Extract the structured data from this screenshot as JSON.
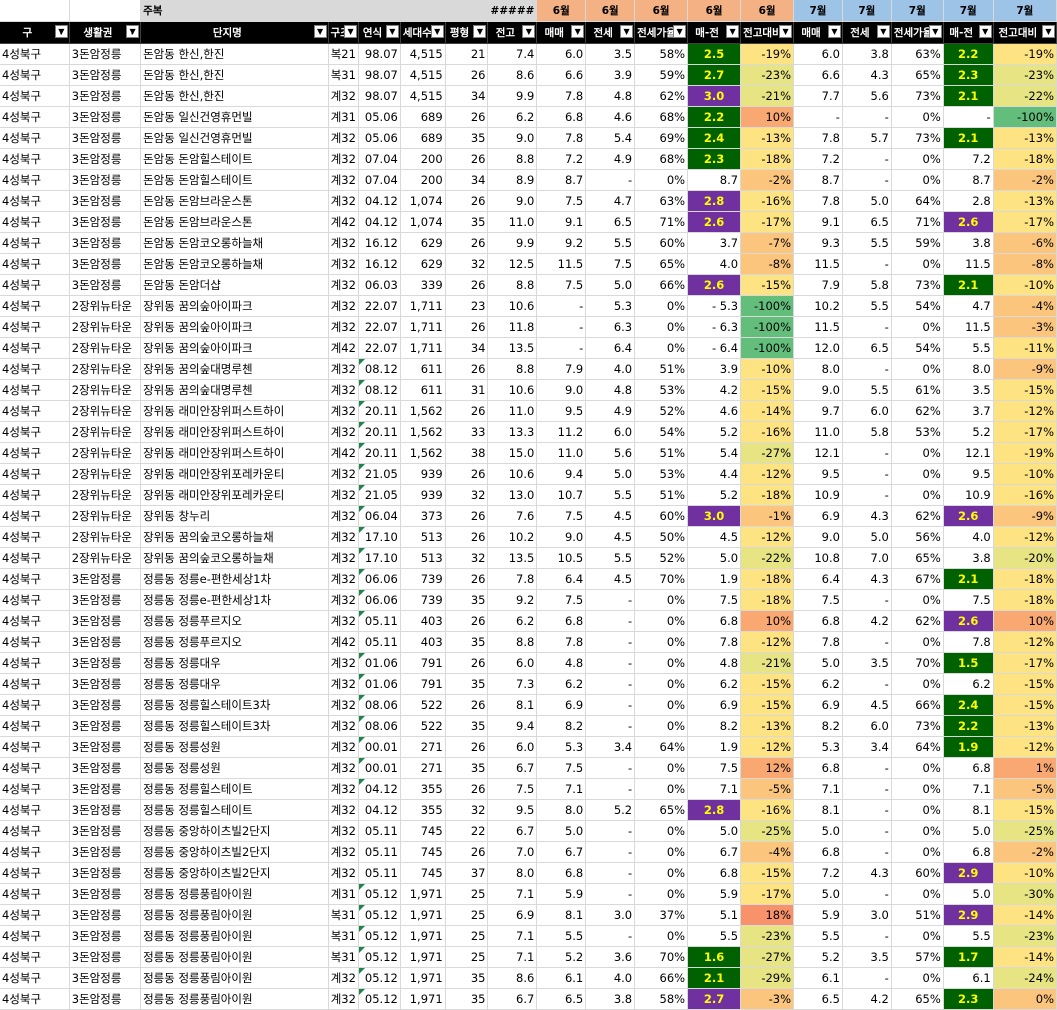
{
  "header_top": {
    "ju": "주복",
    "hash": "#####",
    "m6": "6월",
    "m7": "7월"
  },
  "header_cols": [
    "구",
    "생활권",
    "단지명",
    "구조",
    "연식",
    "세대수",
    "평형",
    "전고",
    "매매",
    "전세",
    "전세가율",
    "매-전",
    "전고대비",
    "매매",
    "전세",
    "전세가율",
    "매-전",
    "전고대비"
  ],
  "rows": [
    [
      "4성북구",
      "3돈암정릉",
      "돈암동 한신,한진",
      "복21",
      "98.07",
      "4,515",
      "21",
      "7.4",
      "6.0",
      "3.5",
      "58%",
      "2.5",
      "-19%",
      "6.0",
      "3.8",
      "63%",
      "2.2",
      "-19%"
    ],
    [
      "4성북구",
      "3돈암정릉",
      "돈암동 한신,한진",
      "복31",
      "98.07",
      "4,515",
      "26",
      "8.6",
      "6.6",
      "3.9",
      "59%",
      "2.7",
      "-23%",
      "6.6",
      "4.3",
      "65%",
      "2.3",
      "-23%"
    ],
    [
      "4성북구",
      "3돈암정릉",
      "돈암동 한신,한진",
      "계32",
      "98.07",
      "4,515",
      "34",
      "9.9",
      "7.8",
      "4.8",
      "62%",
      "3.0",
      "-21%",
      "7.7",
      "5.6",
      "73%",
      "2.1",
      "-22%"
    ],
    [
      "4성북구",
      "3돈암정릉",
      "돈암동 일신건영휴먼빌",
      "계31",
      "05.06",
      "689",
      "26",
      "6.2",
      "6.8",
      "4.6",
      "68%",
      "2.2",
      "10%",
      "-",
      "-",
      "0%",
      "-",
      "-100%"
    ],
    [
      "4성북구",
      "3돈암정릉",
      "돈암동 일신건영휴먼빌",
      "계32",
      "05.06",
      "689",
      "35",
      "9.0",
      "7.8",
      "5.4",
      "69%",
      "2.4",
      "-13%",
      "7.8",
      "5.7",
      "73%",
      "2.1",
      "-13%"
    ],
    [
      "4성북구",
      "3돈암정릉",
      "돈암동 돈암힐스테이트",
      "계32",
      "07.04",
      "200",
      "26",
      "8.8",
      "7.2",
      "4.9",
      "68%",
      "2.3",
      "-18%",
      "7.2",
      "-",
      "0%",
      "7.2",
      "-18%"
    ],
    [
      "4성북구",
      "3돈암정릉",
      "돈암동 돈암힐스테이트",
      "계32",
      "07.04",
      "200",
      "34",
      "8.9",
      "8.7",
      "-",
      "0%",
      "8.7",
      "-2%",
      "8.7",
      "-",
      "0%",
      "8.7",
      "-2%"
    ],
    [
      "4성북구",
      "3돈암정릉",
      "돈암동 돈암브라운스톤",
      "계32",
      "04.12",
      "1,074",
      "26",
      "9.0",
      "7.5",
      "4.7",
      "63%",
      "2.8",
      "-16%",
      "7.8",
      "5.0",
      "64%",
      "2.8",
      "-13%"
    ],
    [
      "4성북구",
      "3돈암정릉",
      "돈암동 돈암브라운스톤",
      "계42",
      "04.12",
      "1,074",
      "35",
      "11.0",
      "9.1",
      "6.5",
      "71%",
      "2.6",
      "-17%",
      "9.1",
      "6.5",
      "71%",
      "2.6",
      "-17%"
    ],
    [
      "4성북구",
      "3돈암정릉",
      "돈암동 돈암코오롱하늘채",
      "계32",
      "16.12",
      "629",
      "26",
      "9.9",
      "9.2",
      "5.5",
      "60%",
      "3.7",
      "-7%",
      "9.3",
      "5.5",
      "59%",
      "3.8",
      "-6%"
    ],
    [
      "4성북구",
      "3돈암정릉",
      "돈암동 돈암코오롱하늘채",
      "계32",
      "16.12",
      "629",
      "32",
      "12.5",
      "11.5",
      "7.5",
      "65%",
      "4.0",
      "-8%",
      "11.5",
      "-",
      "0%",
      "11.5",
      "-8%"
    ],
    [
      "4성북구",
      "3돈암정릉",
      "돈암동 돈암더샵",
      "계32",
      "06.03",
      "339",
      "26",
      "8.8",
      "7.5",
      "5.0",
      "66%",
      "2.6",
      "-15%",
      "7.9",
      "5.8",
      "73%",
      "2.1",
      "-10%"
    ],
    [
      "4성북구",
      "2장위뉴타운",
      "장위동 꿈의숲아이파크",
      "계32",
      "22.07",
      "1,711",
      "23",
      "10.6",
      "-",
      "5.3",
      "0%",
      "- 5.3",
      "-100%",
      "10.2",
      "5.5",
      "54%",
      "4.7",
      "-4%"
    ],
    [
      "4성북구",
      "2장위뉴타운",
      "장위동 꿈의숲아이파크",
      "계32",
      "22.07",
      "1,711",
      "26",
      "11.8",
      "-",
      "6.3",
      "0%",
      "- 6.3",
      "-100%",
      "11.5",
      "-",
      "0%",
      "11.5",
      "-3%"
    ],
    [
      "4성북구",
      "2장위뉴타운",
      "장위동 꿈의숲아이파크",
      "계42",
      "22.07",
      "1,711",
      "34",
      "13.5",
      "-",
      "6.4",
      "0%",
      "- 6.4",
      "-100%",
      "12.0",
      "6.5",
      "54%",
      "5.5",
      "-11%"
    ],
    [
      "4성북구",
      "2장위뉴타운",
      "장위동 꿈의숲대명루첸",
      "계32",
      "08.12",
      "611",
      "26",
      "8.8",
      "7.9",
      "4.0",
      "51%",
      "3.9",
      "-10%",
      "8.0",
      "-",
      "0%",
      "8.0",
      "-9%"
    ],
    [
      "4성북구",
      "2장위뉴타운",
      "장위동 꿈의숲대명루첸",
      "계32",
      "08.12",
      "611",
      "31",
      "10.6",
      "9.0",
      "4.8",
      "53%",
      "4.2",
      "-15%",
      "9.0",
      "5.5",
      "61%",
      "3.5",
      "-15%"
    ],
    [
      "4성북구",
      "2장위뉴타운",
      "장위동 래미안장위퍼스트하이",
      "계32",
      "20.11",
      "1,562",
      "26",
      "11.0",
      "9.5",
      "4.9",
      "52%",
      "4.6",
      "-14%",
      "9.7",
      "6.0",
      "62%",
      "3.7",
      "-12%"
    ],
    [
      "4성북구",
      "2장위뉴타운",
      "장위동 래미안장위퍼스트하이",
      "계32",
      "20.11",
      "1,562",
      "33",
      "13.3",
      "11.2",
      "6.0",
      "54%",
      "5.2",
      "-16%",
      "11.0",
      "5.8",
      "53%",
      "5.2",
      "-17%"
    ],
    [
      "4성북구",
      "2장위뉴타운",
      "장위동 래미안장위퍼스트하이",
      "계42",
      "20.11",
      "1,562",
      "38",
      "15.0",
      "11.0",
      "5.6",
      "51%",
      "5.4",
      "-27%",
      "12.1",
      "-",
      "0%",
      "12.1",
      "-19%"
    ],
    [
      "4성북구",
      "2장위뉴타운",
      "장위동 래미안장위포레카운티",
      "계32",
      "21.05",
      "939",
      "26",
      "10.6",
      "9.4",
      "5.0",
      "53%",
      "4.4",
      "-12%",
      "9.5",
      "-",
      "0%",
      "9.5",
      "-10%"
    ],
    [
      "4성북구",
      "2장위뉴타운",
      "장위동 래미안장위포레카운티",
      "계32",
      "21.05",
      "939",
      "32",
      "13.0",
      "10.7",
      "5.5",
      "51%",
      "5.2",
      "-18%",
      "10.9",
      "-",
      "0%",
      "10.9",
      "-16%"
    ],
    [
      "4성북구",
      "2장위뉴타운",
      "장위동 창누리",
      "계32",
      "06.04",
      "373",
      "26",
      "7.6",
      "7.5",
      "4.5",
      "60%",
      "3.0",
      "-1%",
      "6.9",
      "4.3",
      "62%",
      "2.6",
      "-9%"
    ],
    [
      "4성북구",
      "2장위뉴타운",
      "장위동 꿈의숲코오롱하늘채",
      "계32",
      "17.10",
      "513",
      "26",
      "10.2",
      "9.0",
      "4.5",
      "50%",
      "4.5",
      "-12%",
      "9.0",
      "5.0",
      "56%",
      "4.0",
      "-12%"
    ],
    [
      "4성북구",
      "2장위뉴타운",
      "장위동 꿈의숲코오롱하늘채",
      "계32",
      "17.10",
      "513",
      "32",
      "13.5",
      "10.5",
      "5.5",
      "52%",
      "5.0",
      "-22%",
      "10.8",
      "7.0",
      "65%",
      "3.8",
      "-20%"
    ],
    [
      "4성북구",
      "3돈암정릉",
      "정릉동 정릉e-편한세상1차",
      "계32",
      "06.06",
      "739",
      "26",
      "7.8",
      "6.4",
      "4.5",
      "70%",
      "1.9",
      "-18%",
      "6.4",
      "4.3",
      "67%",
      "2.1",
      "-18%"
    ],
    [
      "4성북구",
      "3돈암정릉",
      "정릉동 정릉e-편한세상1차",
      "계32",
      "06.06",
      "739",
      "35",
      "9.2",
      "7.5",
      "-",
      "0%",
      "7.5",
      "-18%",
      "7.5",
      "-",
      "0%",
      "7.5",
      "-18%"
    ],
    [
      "4성북구",
      "3돈암정릉",
      "정릉동 정릉푸르지오",
      "계32",
      "05.11",
      "403",
      "26",
      "6.2",
      "6.8",
      "-",
      "0%",
      "6.8",
      "10%",
      "6.8",
      "4.2",
      "62%",
      "2.6",
      "10%"
    ],
    [
      "4성북구",
      "3돈암정릉",
      "정릉동 정릉푸르지오",
      "계42",
      "05.11",
      "403",
      "35",
      "8.8",
      "7.8",
      "-",
      "0%",
      "7.8",
      "-12%",
      "7.8",
      "-",
      "0%",
      "7.8",
      "-12%"
    ],
    [
      "4성북구",
      "3돈암정릉",
      "정릉동 정릉대우",
      "계32",
      "01.06",
      "791",
      "26",
      "6.0",
      "4.8",
      "-",
      "0%",
      "4.8",
      "-21%",
      "5.0",
      "3.5",
      "70%",
      "1.5",
      "-17%"
    ],
    [
      "4성북구",
      "3돈암정릉",
      "정릉동 정릉대우",
      "계32",
      "01.06",
      "791",
      "35",
      "7.3",
      "6.2",
      "-",
      "0%",
      "6.2",
      "-15%",
      "6.2",
      "-",
      "0%",
      "6.2",
      "-15%"
    ],
    [
      "4성북구",
      "3돈암정릉",
      "정릉동 정릉힐스테이트3차",
      "계32",
      "08.06",
      "522",
      "26",
      "8.1",
      "6.9",
      "-",
      "0%",
      "6.9",
      "-15%",
      "6.9",
      "4.5",
      "66%",
      "2.4",
      "-15%"
    ],
    [
      "4성북구",
      "3돈암정릉",
      "정릉동 정릉힐스테이트3차",
      "계32",
      "08.06",
      "522",
      "35",
      "9.4",
      "8.2",
      "-",
      "0%",
      "8.2",
      "-13%",
      "8.2",
      "6.0",
      "73%",
      "2.2",
      "-13%"
    ],
    [
      "4성북구",
      "3돈암정릉",
      "정릉동 정릉성원",
      "계32",
      "00.01",
      "271",
      "26",
      "6.0",
      "5.3",
      "3.4",
      "64%",
      "1.9",
      "-12%",
      "5.3",
      "3.4",
      "64%",
      "1.9",
      "-12%"
    ],
    [
      "4성북구",
      "3돈암정릉",
      "정릉동 정릉성원",
      "계32",
      "00.01",
      "271",
      "35",
      "6.7",
      "7.5",
      "-",
      "0%",
      "7.5",
      "12%",
      "6.8",
      "-",
      "0%",
      "6.8",
      "1%"
    ],
    [
      "4성북구",
      "3돈암정릉",
      "정릉동 정릉힐스테이트",
      "계32",
      "04.12",
      "355",
      "26",
      "7.5",
      "7.1",
      "-",
      "0%",
      "7.1",
      "-5%",
      "7.1",
      "-",
      "0%",
      "7.1",
      "-5%"
    ],
    [
      "4성북구",
      "3돈암정릉",
      "정릉동 정릉힐스테이트",
      "계32",
      "04.12",
      "355",
      "32",
      "9.5",
      "8.0",
      "5.2",
      "65%",
      "2.8",
      "-16%",
      "8.1",
      "-",
      "0%",
      "8.1",
      "-15%"
    ],
    [
      "4성북구",
      "3돈암정릉",
      "정릉동 중앙하이츠빌2단지",
      "계32",
      "05.11",
      "745",
      "22",
      "6.7",
      "5.0",
      "-",
      "0%",
      "5.0",
      "-25%",
      "5.0",
      "-",
      "0%",
      "5.0",
      "-25%"
    ],
    [
      "4성북구",
      "3돈암정릉",
      "정릉동 중앙하이츠빌2단지",
      "계32",
      "05.11",
      "745",
      "26",
      "7.0",
      "6.7",
      "-",
      "0%",
      "6.7",
      "-4%",
      "6.8",
      "-",
      "0%",
      "6.8",
      "-2%"
    ],
    [
      "4성북구",
      "3돈암정릉",
      "정릉동 중앙하이츠빌2단지",
      "계32",
      "05.11",
      "745",
      "37",
      "8.0",
      "6.8",
      "-",
      "0%",
      "6.8",
      "-15%",
      "7.2",
      "4.3",
      "60%",
      "2.9",
      "-10%"
    ],
    [
      "4성북구",
      "3돈암정릉",
      "정릉동 정릉풍림아이원",
      "계31",
      "05.12",
      "1,971",
      "25",
      "7.1",
      "5.9",
      "-",
      "0%",
      "5.9",
      "-17%",
      "5.0",
      "-",
      "0%",
      "5.0",
      "-30%"
    ],
    [
      "4성북구",
      "3돈암정릉",
      "정릉동 정릉풍림아이원",
      "복31",
      "05.12",
      "1,971",
      "25",
      "6.9",
      "8.1",
      "3.0",
      "37%",
      "5.1",
      "18%",
      "5.9",
      "3.0",
      "51%",
      "2.9",
      "-14%"
    ],
    [
      "4성북구",
      "3돈암정릉",
      "정릉동 정릉풍림아이원",
      "복31",
      "05.12",
      "1,971",
      "25",
      "7.1",
      "5.5",
      "-",
      "0%",
      "5.5",
      "-23%",
      "5.5",
      "-",
      "0%",
      "5.5",
      "-23%"
    ],
    [
      "4성북구",
      "3돈암정릉",
      "정릉동 정릉풍림아이원",
      "복31",
      "05.12",
      "1,971",
      "25",
      "7.1",
      "5.2",
      "3.6",
      "70%",
      "1.6",
      "-27%",
      "5.2",
      "3.5",
      "57%",
      "1.7",
      "-14%"
    ],
    [
      "4성북구",
      "3돈암정릉",
      "정릉동 정릉풍림아이원",
      "계32",
      "05.12",
      "1,971",
      "35",
      "8.6",
      "6.1",
      "4.0",
      "66%",
      "2.1",
      "-29%",
      "6.1",
      "-",
      "0%",
      "6.1",
      "-24%"
    ],
    [
      "4성북구",
      "3돈암정릉",
      "정릉동 정릉풍림아이원",
      "계32",
      "05.12",
      "1,971",
      "35",
      "6.7",
      "6.5",
      "3.8",
      "58%",
      "2.7",
      "-3%",
      "6.5",
      "4.2",
      "65%",
      "2.3",
      "0%"
    ]
  ],
  "cell_colors": {
    "badge_green": "#006100",
    "badge_purple": "#7030a0",
    "badge_text": "#ffff00",
    "month6": "#f4b183",
    "month7": "#9dc3e6"
  },
  "badges6": [
    "g",
    "g",
    "p",
    "g",
    "g",
    "g",
    "",
    "p",
    "p",
    "",
    "",
    "p",
    "",
    "",
    "",
    "",
    "",
    "",
    "",
    "",
    "",
    "",
    "p",
    "",
    "",
    "",
    "",
    "",
    "",
    "",
    "",
    "",
    "",
    "",
    "",
    "",
    "p",
    "",
    "",
    "",
    "",
    "",
    "",
    "g",
    "g",
    "p"
  ],
  "badges7": [
    "g",
    "g",
    "g",
    "",
    "g",
    "",
    "",
    "",
    "p",
    "",
    "",
    "g",
    "",
    "",
    "",
    "",
    "",
    "",
    "",
    "",
    "",
    "",
    "p",
    "",
    "",
    "g",
    "",
    "p",
    "",
    "g",
    "",
    "g",
    "g",
    "g",
    "",
    "",
    "",
    "",
    "",
    "p",
    "",
    "p",
    "",
    "g",
    "",
    "g"
  ],
  "tri_rows": [
    15,
    16,
    17,
    18,
    19,
    20,
    21,
    22,
    23,
    24,
    25,
    26,
    27,
    29,
    30,
    31,
    32,
    33,
    34,
    35,
    40,
    41,
    42,
    43,
    44,
    45
  ]
}
